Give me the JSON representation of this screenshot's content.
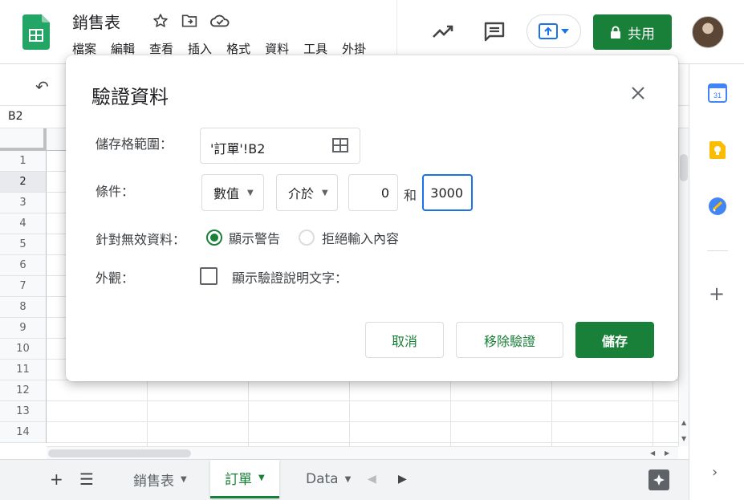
{
  "app": {
    "doc_title": "銷售表",
    "menu": [
      "檔案",
      "編輯",
      "查看",
      "插入",
      "格式",
      "資料",
      "工具",
      "外掛"
    ],
    "share_label": "共用",
    "name_box": "B2",
    "brand_color": "#188038"
  },
  "grid": {
    "rows": [
      "1",
      "2",
      "3",
      "4",
      "5",
      "6",
      "7",
      "8",
      "9",
      "10",
      "11",
      "12",
      "13",
      "14"
    ],
    "selected_row": "2"
  },
  "sheets": {
    "tabs": [
      {
        "label": "銷售表",
        "active": false
      },
      {
        "label": "訂單",
        "active": true
      },
      {
        "label": "Data",
        "active": false
      }
    ]
  },
  "dialog": {
    "title": "驗證資料",
    "range_label": "儲存格範圍：",
    "range_value": "'訂單'!B2",
    "criteria_label": "條件：",
    "criteria_type": "數值",
    "criteria_op": "介於",
    "min_value": "0",
    "and_label": "和",
    "max_value": "3000",
    "invalid_label": "針對無效資料：",
    "invalid_options": [
      "顯示警告",
      "拒絕輸入內容"
    ],
    "invalid_selected": "顯示警告",
    "appearance_label": "外觀：",
    "show_help_label": "顯示驗證說明文字：",
    "show_help_checked": false,
    "cancel_label": "取消",
    "remove_label": "移除驗證",
    "save_label": "儲存"
  }
}
